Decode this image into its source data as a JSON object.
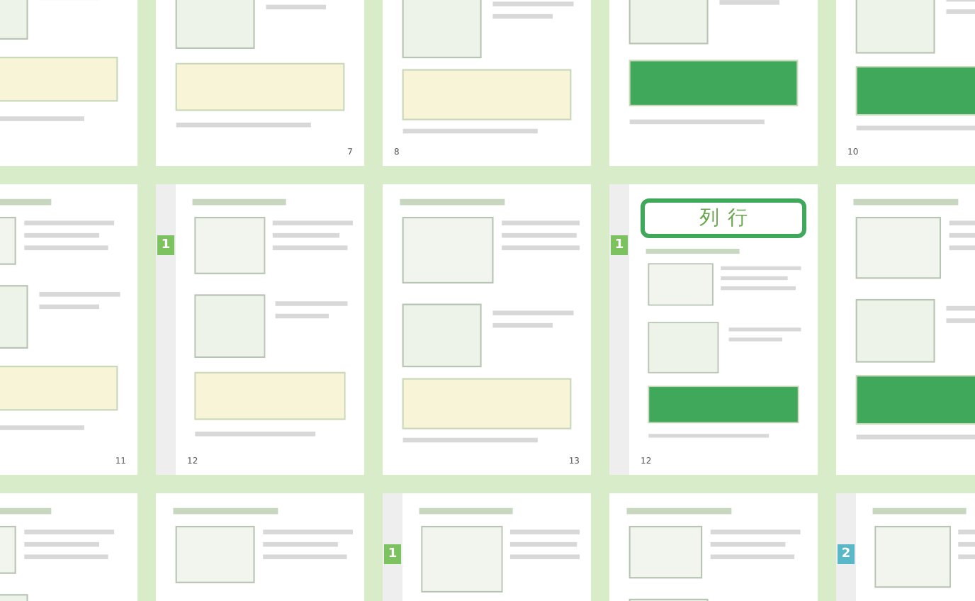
{
  "pages": [
    {
      "kind": "recto"
    },
    {
      "kind": "recto",
      "page_number": "7"
    },
    {
      "kind": "verso",
      "page_number": "8"
    },
    {
      "kind": "verso"
    },
    {
      "kind": "verso",
      "page_number": "10"
    },
    {
      "kind": "recto",
      "page_number": "11"
    },
    {
      "kind": "verso",
      "page_number": "12",
      "chapter_tab": "1"
    },
    {
      "kind": "recto",
      "page_number": "13"
    },
    {
      "kind": "verso",
      "page_number": "12",
      "chapter_tab": "1",
      "big_chars": [
        "列",
        "行"
      ]
    },
    {
      "kind": "recto"
    },
    {
      "kind": "recto"
    },
    {
      "kind": "verso"
    },
    {
      "kind": "verso",
      "chapter_tab": "1"
    },
    {
      "kind": "recto"
    },
    {
      "kind": "verso",
      "chapter_tab": "2"
    }
  ]
}
